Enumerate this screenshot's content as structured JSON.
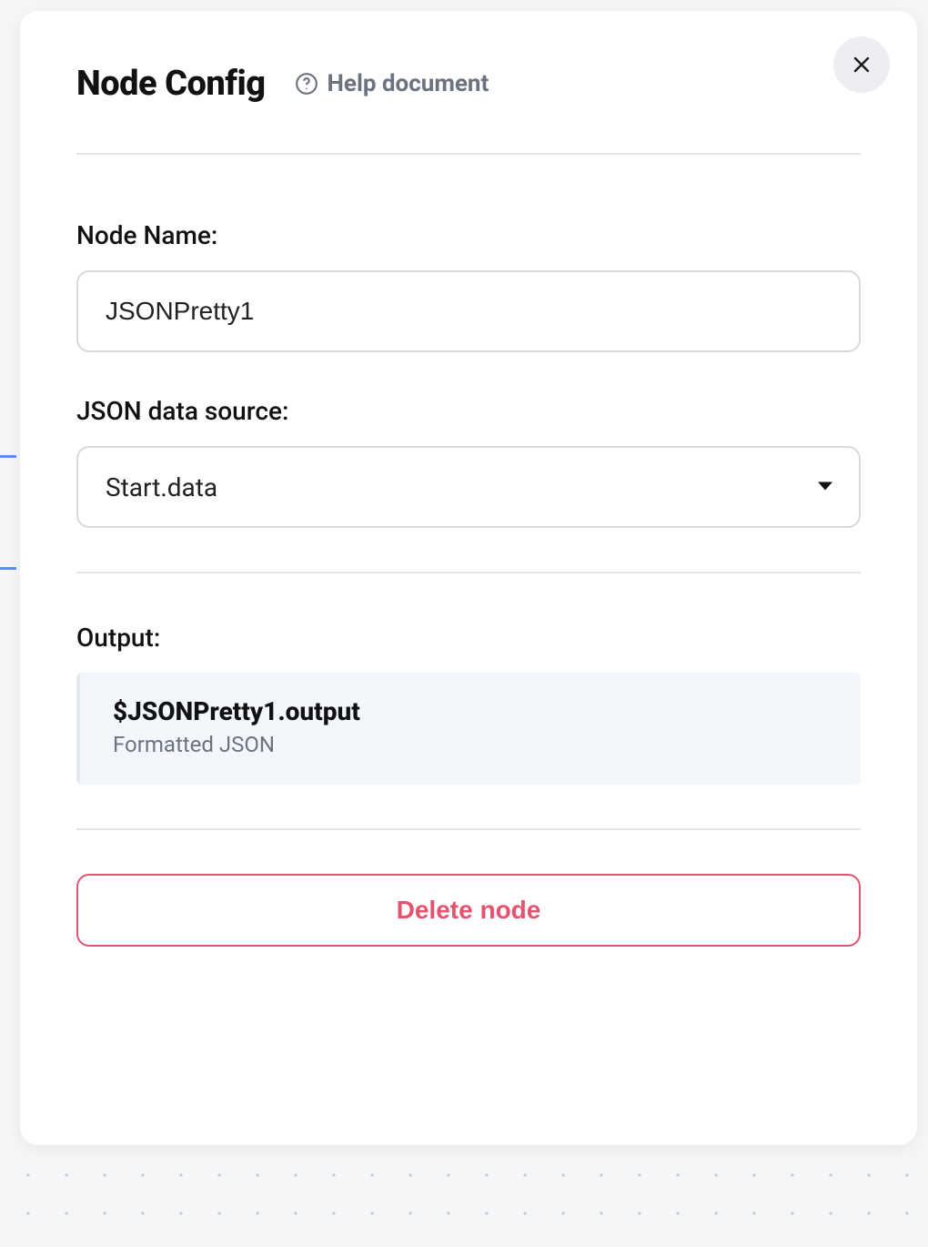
{
  "panel": {
    "title": "Node Config",
    "help_label": "Help document"
  },
  "fields": {
    "node_name": {
      "label": "Node Name:",
      "value": "JSONPretty1"
    },
    "data_source": {
      "label": "JSON data source:",
      "value": "Start.data"
    }
  },
  "output": {
    "label": "Output:",
    "variable": "$JSONPretty1.output",
    "description": "Formatted JSON"
  },
  "actions": {
    "delete_label": "Delete node"
  }
}
